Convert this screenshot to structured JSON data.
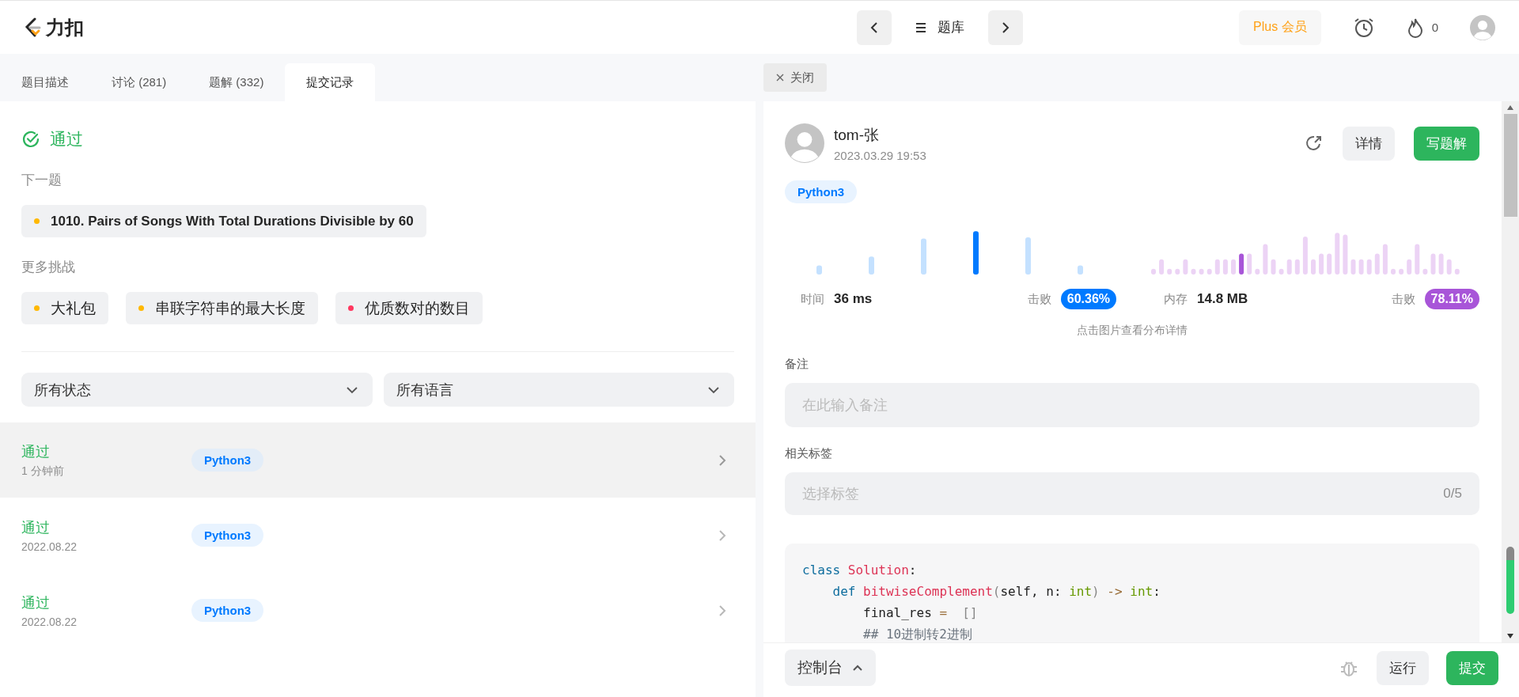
{
  "header": {
    "logo_text": "力扣",
    "nav_title": "题库",
    "plus_button": "Plus 会员",
    "streak_count": "0"
  },
  "tabs": [
    {
      "label": "题目描述",
      "selected": false
    },
    {
      "label": "讨论 (281)",
      "selected": false
    },
    {
      "label": "题解 (332)",
      "selected": false
    },
    {
      "label": "提交记录",
      "selected": true
    }
  ],
  "close_tab": {
    "label": "关闭"
  },
  "result": {
    "status": "通过",
    "next_label": "下一题",
    "next_problem": {
      "title": "1010. Pairs of Songs With Total Durations Divisible by 60",
      "color": "#ffb800"
    },
    "more_label": "更多挑战",
    "challenges": [
      {
        "title": "大礼包",
        "color": "#ffb800"
      },
      {
        "title": "串联字符串的最大长度",
        "color": "#ffb800"
      },
      {
        "title": "优质数对的数目",
        "color": "#ff375f"
      }
    ]
  },
  "filters": [
    {
      "placeholder": "所有状态"
    },
    {
      "placeholder": "所有语言"
    }
  ],
  "submissions": [
    {
      "status": "通过",
      "time": "1 分钟前",
      "language": "Python3",
      "selected": true
    },
    {
      "status": "通过",
      "time": "2022.08.22",
      "language": "Python3",
      "selected": false
    },
    {
      "status": "通过",
      "time": "2022.08.22",
      "language": "Python3",
      "selected": false
    }
  ],
  "detail": {
    "user": "tom-张",
    "date": "2023.03.29 19:53",
    "details_button": "详情",
    "write_button": "写题解",
    "language": "Python3",
    "runtime": {
      "label": "时间",
      "value": "36 ms",
      "beat_label": "击败",
      "beat": "60.36%"
    },
    "memory": {
      "label": "内存",
      "value": "14.8 MB",
      "beat_label": "击败",
      "beat": "78.11%"
    },
    "chart_hint": "点击图片查看分布详情",
    "note_label": "备注",
    "note": {
      "placeholder": "在此输入备注"
    },
    "tags_label": "相关标签",
    "tags": {
      "placeholder": "选择标签",
      "count": "0/5"
    },
    "code": [
      [
        {
          "text": "class ",
          "kind": "keyword"
        },
        {
          "text": "Solution",
          "kind": "name"
        },
        {
          "text": ":",
          "kind": "plain"
        }
      ],
      [
        {
          "text": "    def ",
          "kind": "keyword"
        },
        {
          "text": "bitwiseComplement",
          "kind": "name"
        },
        {
          "text": "(",
          "kind": "punct"
        },
        {
          "text": "self, n",
          "kind": "plain"
        },
        {
          "text": ": ",
          "kind": "plain"
        },
        {
          "text": "int",
          "kind": "type"
        },
        {
          "text": ") ",
          "kind": "punct"
        },
        {
          "text": "-> ",
          "kind": "op"
        },
        {
          "text": "int",
          "kind": "type"
        },
        {
          "text": ":",
          "kind": "plain"
        }
      ],
      [
        {
          "text": "        final_res ",
          "kind": "plain"
        },
        {
          "text": "=",
          "kind": "op"
        },
        {
          "text": "  []",
          "kind": "punct"
        }
      ],
      [
        {
          "text": "        ## 10进制转2进制",
          "kind": "comment"
        }
      ]
    ]
  },
  "bottom_bar": {
    "console_button": "控制台",
    "run_button": "运行",
    "submit_button": "提交"
  }
}
